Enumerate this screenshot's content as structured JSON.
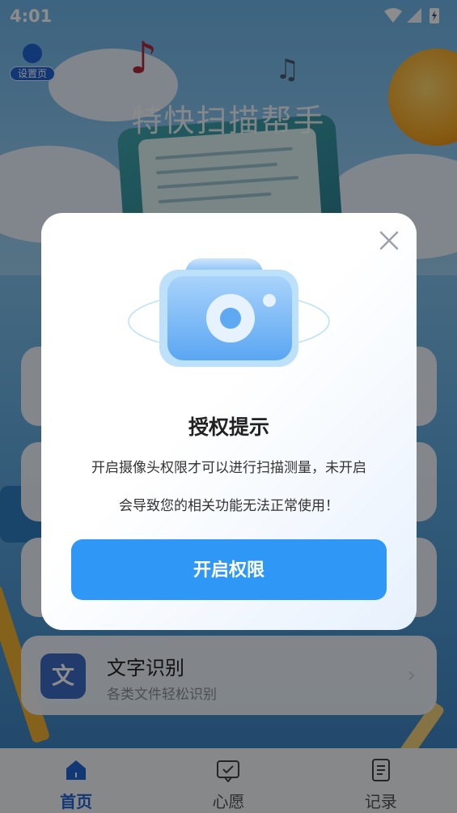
{
  "status_bar": {
    "time": "4:01"
  },
  "header": {
    "settings_label": "设置页",
    "app_title": "特快扫描帮手"
  },
  "features": [
    {
      "title": "",
      "subtitle": ""
    },
    {
      "title": "",
      "subtitle": ""
    },
    {
      "title": "",
      "subtitle": ""
    },
    {
      "icon_char": "文",
      "title": "文字识别",
      "subtitle": "各类文件轻松识别"
    }
  ],
  "tabbar": {
    "tabs": [
      {
        "label": "首页",
        "icon": "home-icon",
        "active": true
      },
      {
        "label": "心愿",
        "icon": "wish-board-icon",
        "active": false
      },
      {
        "label": "记录",
        "icon": "record-list-icon",
        "active": false
      }
    ]
  },
  "dialog": {
    "title": "授权提示",
    "message_line1": "开启摄像头权限才可以进行扫描测量，未开启",
    "message_line2": "会导致您的相关功能无法正常使用！",
    "confirm_label": "开启权限",
    "icons": {
      "close": "close-icon",
      "illustration": "camera-icon"
    }
  },
  "colors": {
    "accent": "#2f97f5",
    "active_tab": "#1f64d6",
    "overlay": "rgba(0,0,0,0.45)"
  }
}
